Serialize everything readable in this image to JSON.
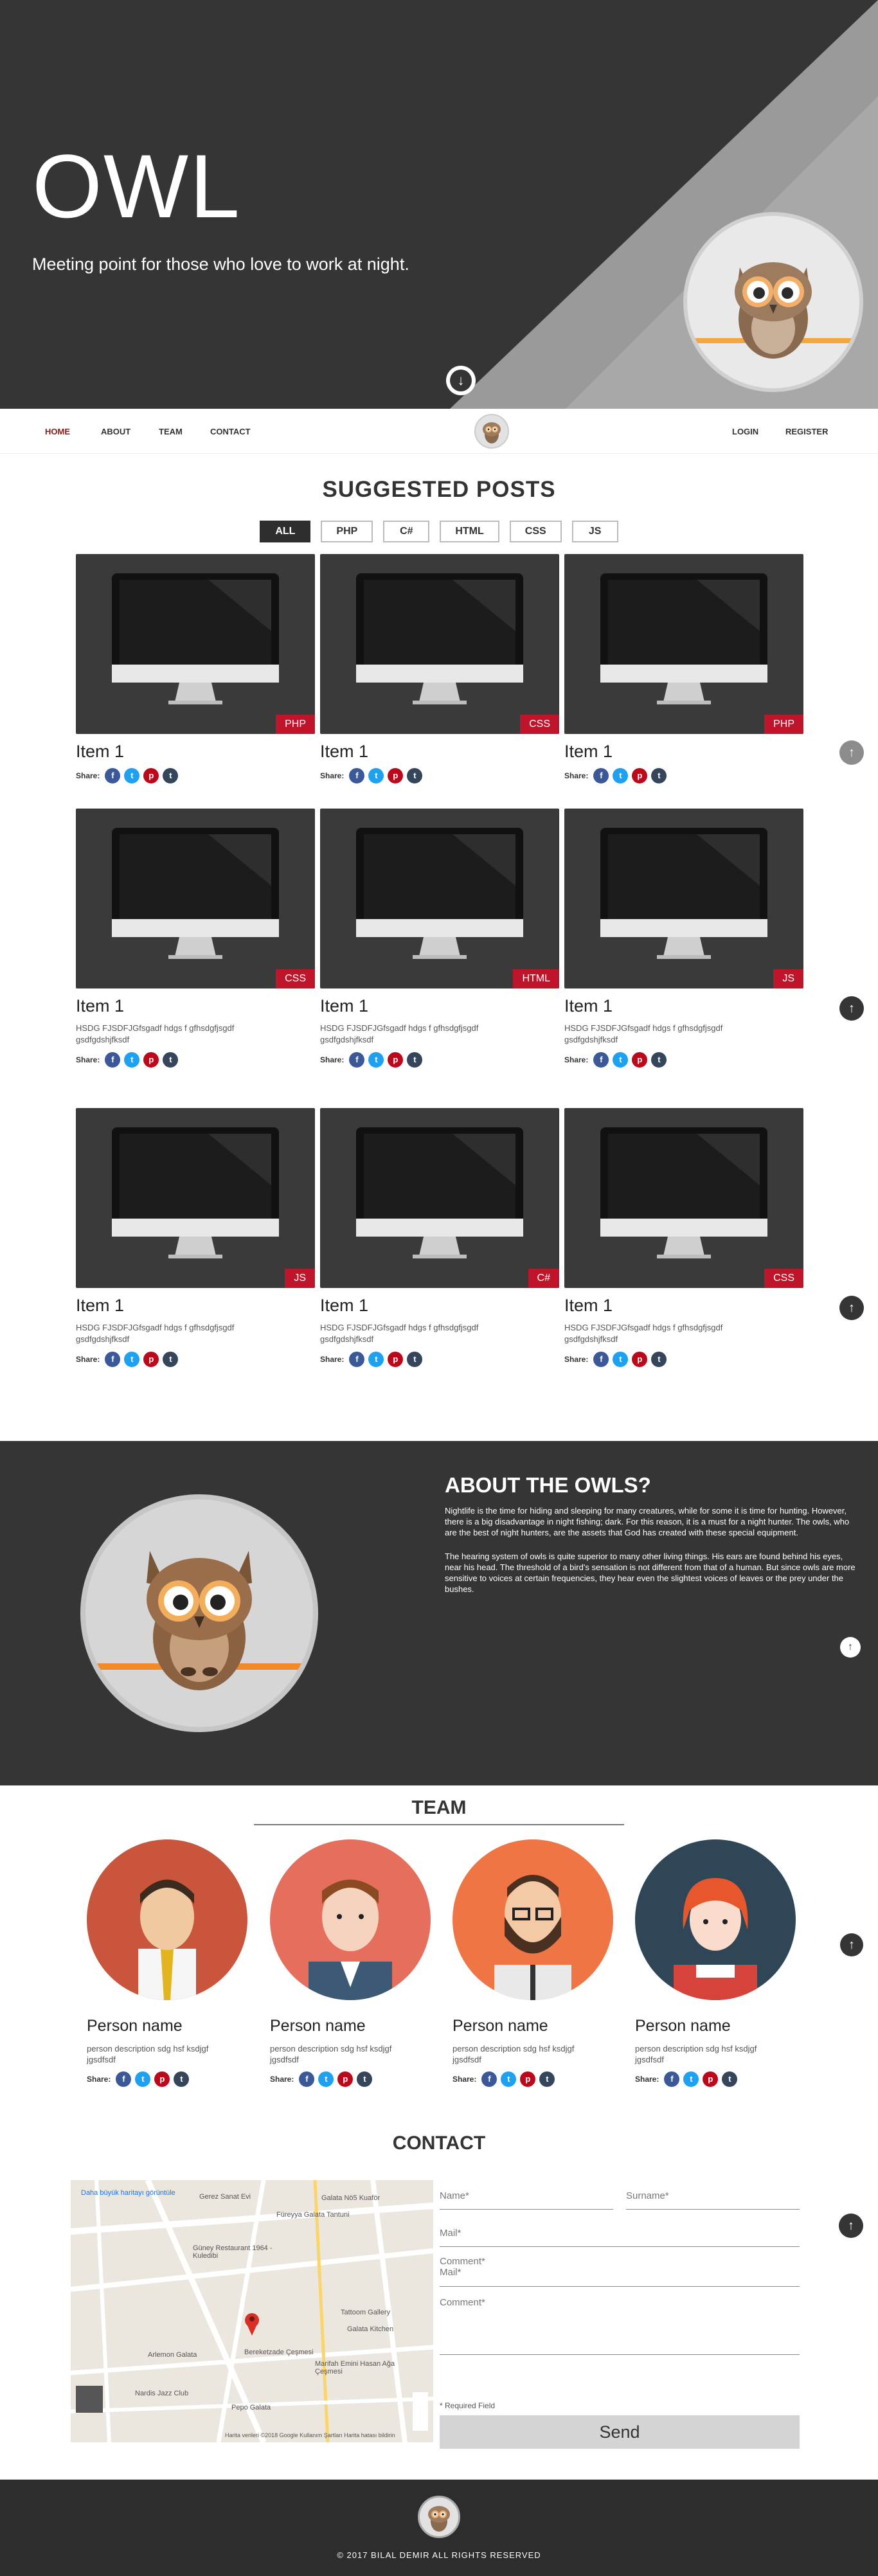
{
  "hero": {
    "title": "OWL",
    "subtitle": "Meeting point for those who love to work at night.",
    "scroll_down_icon": "arrow-down-circle-icon"
  },
  "nav": {
    "left": [
      "HOME",
      "ABOUT",
      "TEAM",
      "CONTACT"
    ],
    "right": [
      "LOGIN",
      "REGISTER"
    ],
    "active": "HOME"
  },
  "posts": {
    "title": "SUGGESTED POSTS",
    "filters": [
      "ALL",
      "PHP",
      "C#",
      "HTML",
      "CSS",
      "JS"
    ],
    "active_filter": "ALL",
    "share_label": "Share:",
    "items": [
      {
        "title": "Item 1",
        "tag": "PHP",
        "desc": ""
      },
      {
        "title": "Item 1",
        "tag": "CSS",
        "desc": ""
      },
      {
        "title": "Item 1",
        "tag": "PHP",
        "desc": ""
      },
      {
        "title": "Item 1",
        "tag": "CSS",
        "desc": "HSDG FJSDFJGfsgadf hdgs f gfhsdgfjsgdf gsdfgdshjfksdf"
      },
      {
        "title": "Item 1",
        "tag": "HTML",
        "desc": "HSDG FJSDFJGfsgadf hdgs f gfhsdgfjsgdf gsdfgdshjfksdf"
      },
      {
        "title": "Item 1",
        "tag": "JS",
        "desc": "HSDG FJSDFJGfsgadf hdgs f gfhsdgfjsgdf gsdfgdshjfksdf"
      },
      {
        "title": "Item 1",
        "tag": "JS",
        "desc": "HSDG FJSDFJGfsgadf hdgs f gfhsdgfjsgdf gsdfgdshjfksdf"
      },
      {
        "title": "Item 1",
        "tag": "C#",
        "desc": "HSDG FJSDFJGfsgadf hdgs f gfhsdgfjsgdf gsdfgdshjfksdf"
      },
      {
        "title": "Item 1",
        "tag": "CSS",
        "desc": "HSDG FJSDFJGfsgadf hdgs f gfhsdgfjsgdf gsdfgdshjfksdf"
      }
    ]
  },
  "about": {
    "title": "ABOUT THE OWLS?",
    "p1": "Nightlife is the time for hiding and sleeping for many creatures, while for some it is time for hunting. However, there is a big disadvantage in night fishing; dark. For this reason, it is a must for a night hunter. The owls, who are the best of night hunters, are the assets that God has created with these special equipment.",
    "p2": "The hearing system of owls is quite superior to many other living things. His ears are found behind his eyes, near his head. The threshold of a bird's sensation is not different from that of a human. But since owls are more sensitive to voices at certain frequencies, they hear even the slightest voices of leaves or the prey under the bushes."
  },
  "team": {
    "title": "TEAM",
    "share_label": "Share:",
    "members": [
      {
        "name": "Person name",
        "desc": "person description sdg hsf ksdjgf jgsdfsdf",
        "bg": "#c9553c"
      },
      {
        "name": "Person name",
        "desc": "person description sdg hsf ksdjgf jgsdfsdf",
        "bg": "#e56e5c"
      },
      {
        "name": "Person name",
        "desc": "person description sdg hsf ksdjgf jgsdfsdf",
        "bg": "#ef7545"
      },
      {
        "name": "Person name",
        "desc": "person description sdg hsf ksdjgf jgsdfsdf",
        "bg": "#2f4657"
      }
    ]
  },
  "contact": {
    "title": "CONTACT",
    "map_note": "Daha büyük haritayı görüntüle",
    "map_labels": [
      "Gerez Sanat Evi",
      "Galata Nö5 Kuaför",
      "Füreyya Galata Tantuni",
      "Güney Restaurant 1964 - Kuledibi",
      "Tattoom Gallery",
      "Galata Kitchen",
      "Bereketzade Çeşmesi",
      "Arlemon Galata",
      "Marifah Emini Hasan Ağa Çeşmesi",
      "Nardis Jazz Club",
      "Pepo Galata"
    ],
    "map_footer": "Harita verileri ©2018 Google   Kullanım Şartları   Harita hatası bildirin",
    "fields": {
      "name": "Name*",
      "surname": "Surname*",
      "mail": "Mail*",
      "comment_mail_1": "Comment*",
      "comment_mail_2": "Mail*",
      "comment": "Comment*"
    },
    "required_note": "* Required Field",
    "send": "Send"
  },
  "footer": {
    "copyright": "© 2017 BILAL DEMIR ALL RIGHTS RESERVED"
  },
  "colors": {
    "dark": "#353535",
    "accent_red": "#c0142a",
    "nav_active": "#8b1a1a"
  }
}
